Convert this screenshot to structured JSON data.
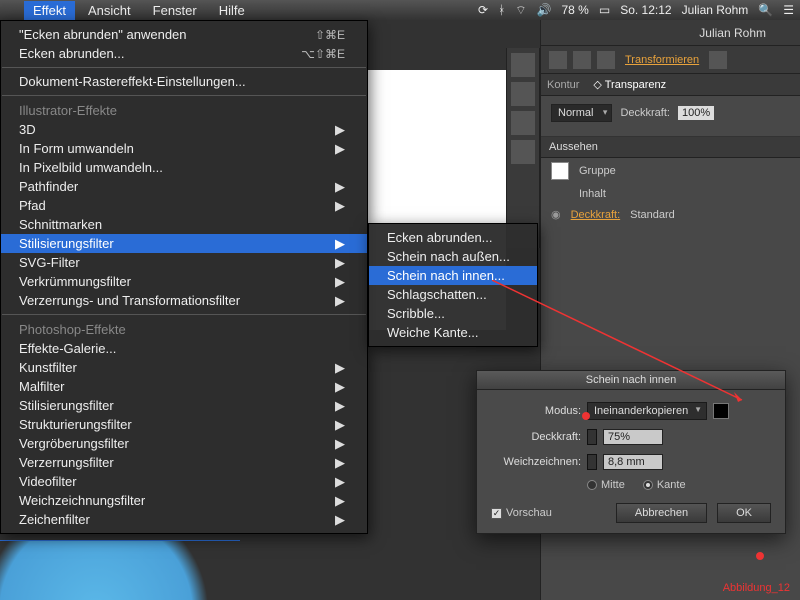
{
  "menubar": {
    "open_menu": "Effekt",
    "items": [
      "Ansicht",
      "Fenster",
      "Hilfe"
    ],
    "battery": "78 %",
    "clock": "So. 12:12",
    "user": "Julian Rohm"
  },
  "menu": {
    "apply_last": "\"Ecken abrunden\" anwenden",
    "apply_last_sc": "⇧⌘E",
    "last": "Ecken abrunden...",
    "last_sc": "⌥⇧⌘E",
    "raster": "Dokument-Rastereffekt-Einstellungen...",
    "hdr_ai": "Illustrator-Effekte",
    "ai": [
      "3D",
      "In Form umwandeln",
      "In Pixelbild umwandeln...",
      "Pathfinder",
      "Pfad",
      "Schnittmarken",
      "Stilisierungsfilter",
      "SVG-Filter",
      "Verkrümmungsfilter",
      "Verzerrungs- und Transformationsfilter"
    ],
    "hdr_ps": "Photoshop-Effekte",
    "ps": [
      "Effekte-Galerie...",
      "Kunstfilter",
      "Malfilter",
      "Stilisierungsfilter",
      "Strukturierungsfilter",
      "Vergröberungsfilter",
      "Verzerrungsfilter",
      "Videofilter",
      "Weichzeichnungsfilter",
      "Zeichenfilter"
    ]
  },
  "submenu": {
    "items": [
      "Ecken abrunden...",
      "Schein nach außen...",
      "Schein nach innen...",
      "Schlagschatten...",
      "Scribble...",
      "Weiche Kante..."
    ],
    "highlighted": 2
  },
  "right": {
    "user": "Julian Rohm",
    "transform": "Transformieren",
    "tab_kontur": "Kontur",
    "tab_transparenz": "Transparenz",
    "blend_mode": "Normal",
    "opacity_lbl": "Deckkraft:",
    "opacity_val": "100%",
    "appear_hdr": "Aussehen",
    "group": "Gruppe",
    "contents": "Inhalt",
    "opacity_link": "Deckkraft:",
    "opacity_std": "Standard"
  },
  "dialog": {
    "title": "Schein nach innen",
    "mode_lbl": "Modus:",
    "mode_val": "Ineinanderkopieren",
    "opacity_lbl": "Deckkraft:",
    "opacity_val": "75%",
    "blur_lbl": "Weichzeichnen:",
    "blur_val": "8,8 mm",
    "radio_center": "Mitte",
    "radio_edge": "Kante",
    "preview": "Vorschau",
    "cancel": "Abbrechen",
    "ok": "OK"
  },
  "annotation": "Abbildung_12"
}
